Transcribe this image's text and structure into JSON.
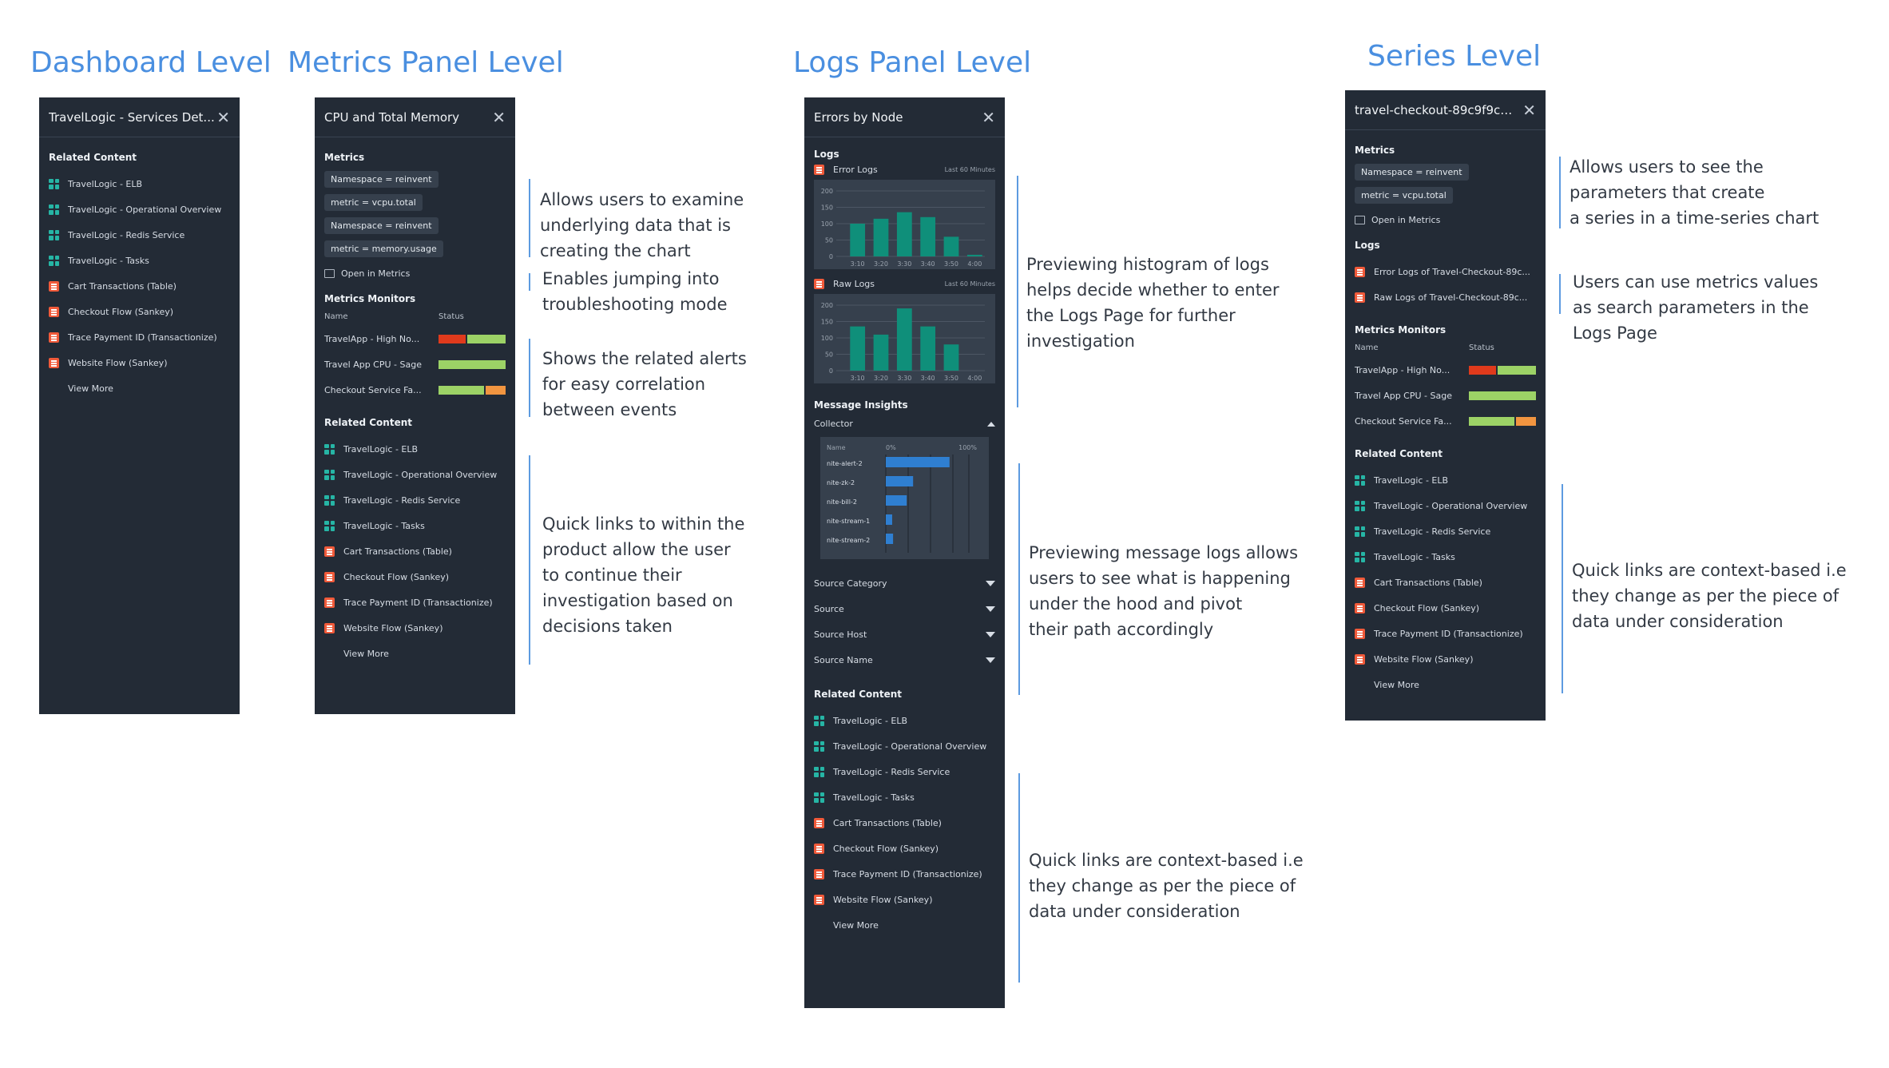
{
  "titles": {
    "dashboard": "Dashboard Level",
    "metrics": "Metrics Panel Level",
    "logs": "Logs Panel Level",
    "series": "Series Level"
  },
  "colors": {
    "accent": "#4a8fe0",
    "panel_bg": "#232b36",
    "dashboard_icon": "#26b5a5",
    "log_icon": "#f05a3a",
    "status_red": "#e03a1c",
    "status_green": "#9cd266",
    "status_orange": "#f29540",
    "chart_bar": "#0f8f7a"
  },
  "dashboard_panel": {
    "title": "TravelLogic - Services Det...",
    "related_heading": "Related Content",
    "related": [
      {
        "label": "TravelLogic - ELB",
        "icon": "dashboard-icon"
      },
      {
        "label": "TravelLogic - Operational Overview",
        "icon": "dashboard-icon"
      },
      {
        "label": "TravelLogic - Redis Service",
        "icon": "dashboard-icon"
      },
      {
        "label": "TravelLogic - Tasks",
        "icon": "dashboard-icon"
      },
      {
        "label": "Cart Transactions (Table)",
        "icon": "log-search-icon"
      },
      {
        "label": "Checkout Flow (Sankey)",
        "icon": "log-search-icon"
      },
      {
        "label": "Trace Payment ID (Transactionize)",
        "icon": "log-search-icon"
      },
      {
        "label": "Website Flow (Sankey)",
        "icon": "log-search-icon"
      }
    ],
    "view_more": "View More"
  },
  "metrics_panel": {
    "title": "CPU and Total Memory",
    "metrics_heading": "Metrics",
    "pills": [
      "Namespace = reinvent",
      "metric = vcpu.total",
      "Namespace = reinvent",
      "metric = memory.usage"
    ],
    "open_in_metrics": "Open in Metrics",
    "monitors_heading": "Metrics Monitors",
    "col_name": "Name",
    "col_status": "Status",
    "monitors": [
      {
        "name": "TravelApp - High No...",
        "status": [
          "red",
          "green"
        ]
      },
      {
        "name": "Travel App CPU - Sage",
        "status": [
          "green"
        ]
      },
      {
        "name": "Checkout Service Fa...",
        "status": [
          "green",
          "orange"
        ]
      }
    ],
    "related_heading": "Related Content",
    "related": [
      {
        "label": "TravelLogic - ELB",
        "icon": "dashboard-icon"
      },
      {
        "label": "TravelLogic - Operational Overview",
        "icon": "dashboard-icon"
      },
      {
        "label": "TravelLogic - Redis Service",
        "icon": "dashboard-icon"
      },
      {
        "label": "TravelLogic - Tasks",
        "icon": "dashboard-icon"
      },
      {
        "label": "Cart Transactions (Table)",
        "icon": "log-search-icon"
      },
      {
        "label": "Checkout Flow (Sankey)",
        "icon": "log-search-icon"
      },
      {
        "label": "Trace Payment ID (Transactionize)",
        "icon": "log-search-icon"
      },
      {
        "label": "Website Flow (Sankey)",
        "icon": "log-search-icon"
      }
    ],
    "view_more": "View More"
  },
  "logs_panel": {
    "title": "Errors by Node",
    "logs_heading": "Logs",
    "error_logs": "Error Logs",
    "raw_logs": "Raw Logs",
    "time_window": "Last 60 Minutes",
    "insights_heading": "Message Insights",
    "collector": "Collector",
    "msg_col_name": "Name",
    "msg_col_min": "0%",
    "msg_col_max": "100%",
    "dropdowns": [
      "Source Category",
      "Source",
      "Source Host",
      "Source Name"
    ],
    "related_heading": "Related Content",
    "related": [
      {
        "label": "TravelLogic - ELB",
        "icon": "dashboard-icon"
      },
      {
        "label": "TravelLogic - Operational Overview",
        "icon": "dashboard-icon"
      },
      {
        "label": "TravelLogic - Redis Service",
        "icon": "dashboard-icon"
      },
      {
        "label": "TravelLogic - Tasks",
        "icon": "dashboard-icon"
      },
      {
        "label": "Cart Transactions (Table)",
        "icon": "log-search-icon"
      },
      {
        "label": "Checkout Flow (Sankey)",
        "icon": "log-search-icon"
      },
      {
        "label": "Trace Payment ID (Transactionize)",
        "icon": "log-search-icon"
      },
      {
        "label": "Website Flow (Sankey)",
        "icon": "log-search-icon"
      }
    ],
    "view_more": "View More"
  },
  "series_panel": {
    "title": "travel-checkout-89c9f9cd...",
    "metrics_heading": "Metrics",
    "pills": [
      "Namespace = reinvent",
      "metric = vcpu.total"
    ],
    "open_in_metrics": "Open in Metrics",
    "logs_heading": "Logs",
    "logs": [
      "Error Logs of Travel-Checkout-89c...",
      "Raw Logs of Travel-Checkout-89c..."
    ],
    "monitors_heading": "Metrics Monitors",
    "col_name": "Name",
    "col_status": "Status",
    "monitors": [
      {
        "name": "TravelApp - High No...",
        "status": [
          "red",
          "green"
        ]
      },
      {
        "name": "Travel App CPU - Sage",
        "status": [
          "green"
        ]
      },
      {
        "name": "Checkout Service Fa...",
        "status": [
          "green",
          "orange"
        ]
      }
    ],
    "related_heading": "Related Content",
    "related": [
      {
        "label": "TravelLogic - ELB",
        "icon": "dashboard-icon"
      },
      {
        "label": "TravelLogic - Operational Overview",
        "icon": "dashboard-icon"
      },
      {
        "label": "TravelLogic - Redis Service",
        "icon": "dashboard-icon"
      },
      {
        "label": "TravelLogic - Tasks",
        "icon": "dashboard-icon"
      },
      {
        "label": "Cart Transactions (Table)",
        "icon": "log-search-icon"
      },
      {
        "label": "Checkout Flow (Sankey)",
        "icon": "log-search-icon"
      },
      {
        "label": "Trace Payment ID (Transactionize)",
        "icon": "log-search-icon"
      },
      {
        "label": "Website Flow (Sankey)",
        "icon": "log-search-icon"
      }
    ],
    "view_more": "View More"
  },
  "notes": {
    "metrics_1": [
      "Allows users to examine",
      "underlying data that is",
      "creating the chart"
    ],
    "metrics_2": [
      "Enables jumping into",
      "troubleshooting mode"
    ],
    "metrics_3": [
      "Shows the related alerts",
      "for easy correlation",
      "between events"
    ],
    "metrics_4": [
      "Quick links to within the",
      "product allow the user",
      "to continue their",
      "investigation based on",
      "decisions taken"
    ],
    "logs_1": [
      "Previewing histogram of logs",
      "helps decide whether to enter",
      "the Logs Page for further",
      "investigation"
    ],
    "logs_2": [
      "Previewing message logs allows",
      "users to see what is happening",
      "under the hood and pivot",
      "their path accordingly"
    ],
    "logs_3": [
      "Quick links are context-based i.e",
      "they change as per the piece of",
      "data under consideration"
    ],
    "series_1": [
      "Allows users to see the",
      "parameters that create",
      "a series in a time-series chart"
    ],
    "series_2": [
      "Users can use metrics values",
      "as search parameters in the",
      "Logs Page"
    ],
    "series_3": [
      "Quick links are context-based i.e",
      "they change as per the piece of",
      "data under consideration"
    ]
  },
  "chart_data": [
    {
      "type": "bar",
      "categories": [
        "3:10",
        "3:20",
        "3:30",
        "3:40",
        "3:50",
        "4:00"
      ],
      "values": [
        100,
        115,
        135,
        120,
        60,
        5
      ],
      "ylim": [
        0,
        200
      ],
      "yticks": [
        0,
        50,
        100,
        150,
        200
      ]
    },
    {
      "type": "bar",
      "categories": [
        "3:10",
        "3:20",
        "3:30",
        "3:40",
        "3:50",
        "4:00"
      ],
      "values": [
        135,
        110,
        190,
        135,
        80
      ],
      "ylim": [
        0,
        200
      ],
      "yticks": [
        0,
        50,
        100,
        150,
        200
      ]
    },
    {
      "type": "bar",
      "orientation": "horizontal",
      "categories": [
        "nite-alert-2",
        "nite-zk-2",
        "nite-bill-2",
        "nite-stream-1",
        "nite-stream-2"
      ],
      "values": [
        70,
        30,
        23,
        7,
        8
      ],
      "xlim": [
        0,
        100
      ]
    }
  ]
}
